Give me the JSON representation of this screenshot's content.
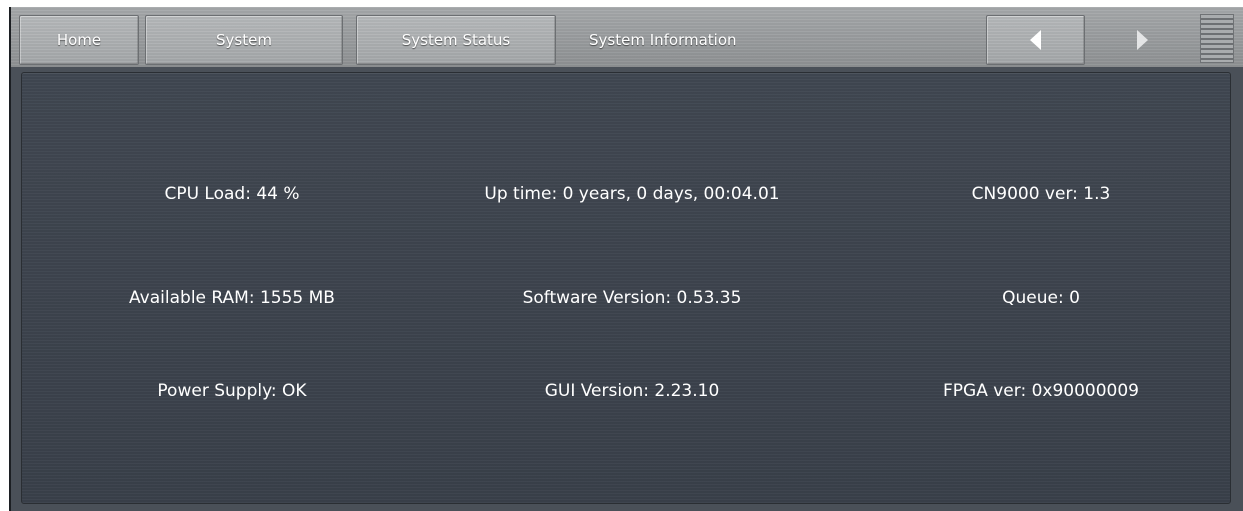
{
  "nav": {
    "home_label": "Home",
    "system_label": "System",
    "system_status_label": "System Status",
    "current_label": "System Information",
    "back_icon": "triangle-left-icon",
    "forward_icon": "triangle-right-icon",
    "menu_icon": "hamburger-menu-icon"
  },
  "info": {
    "cpu_load": "CPU Load: 44 %",
    "up_time": "Up time: 0 years, 0 days, 00:04.01",
    "cn9000_ver": "CN9000 ver: 1.3",
    "available_ram": "Available RAM: 1555 MB",
    "software_version": "Software Version: 0.53.35",
    "queue": "Queue: 0",
    "power_supply": "Power Supply: OK",
    "gui_version": "GUI Version: 2.23.10",
    "fpga_ver": "FPGA ver: 0x90000009"
  },
  "colors": {
    "panel_bg": "#3d444e",
    "topbar_bg": "#9c9fa1",
    "text": "#ffffff"
  }
}
